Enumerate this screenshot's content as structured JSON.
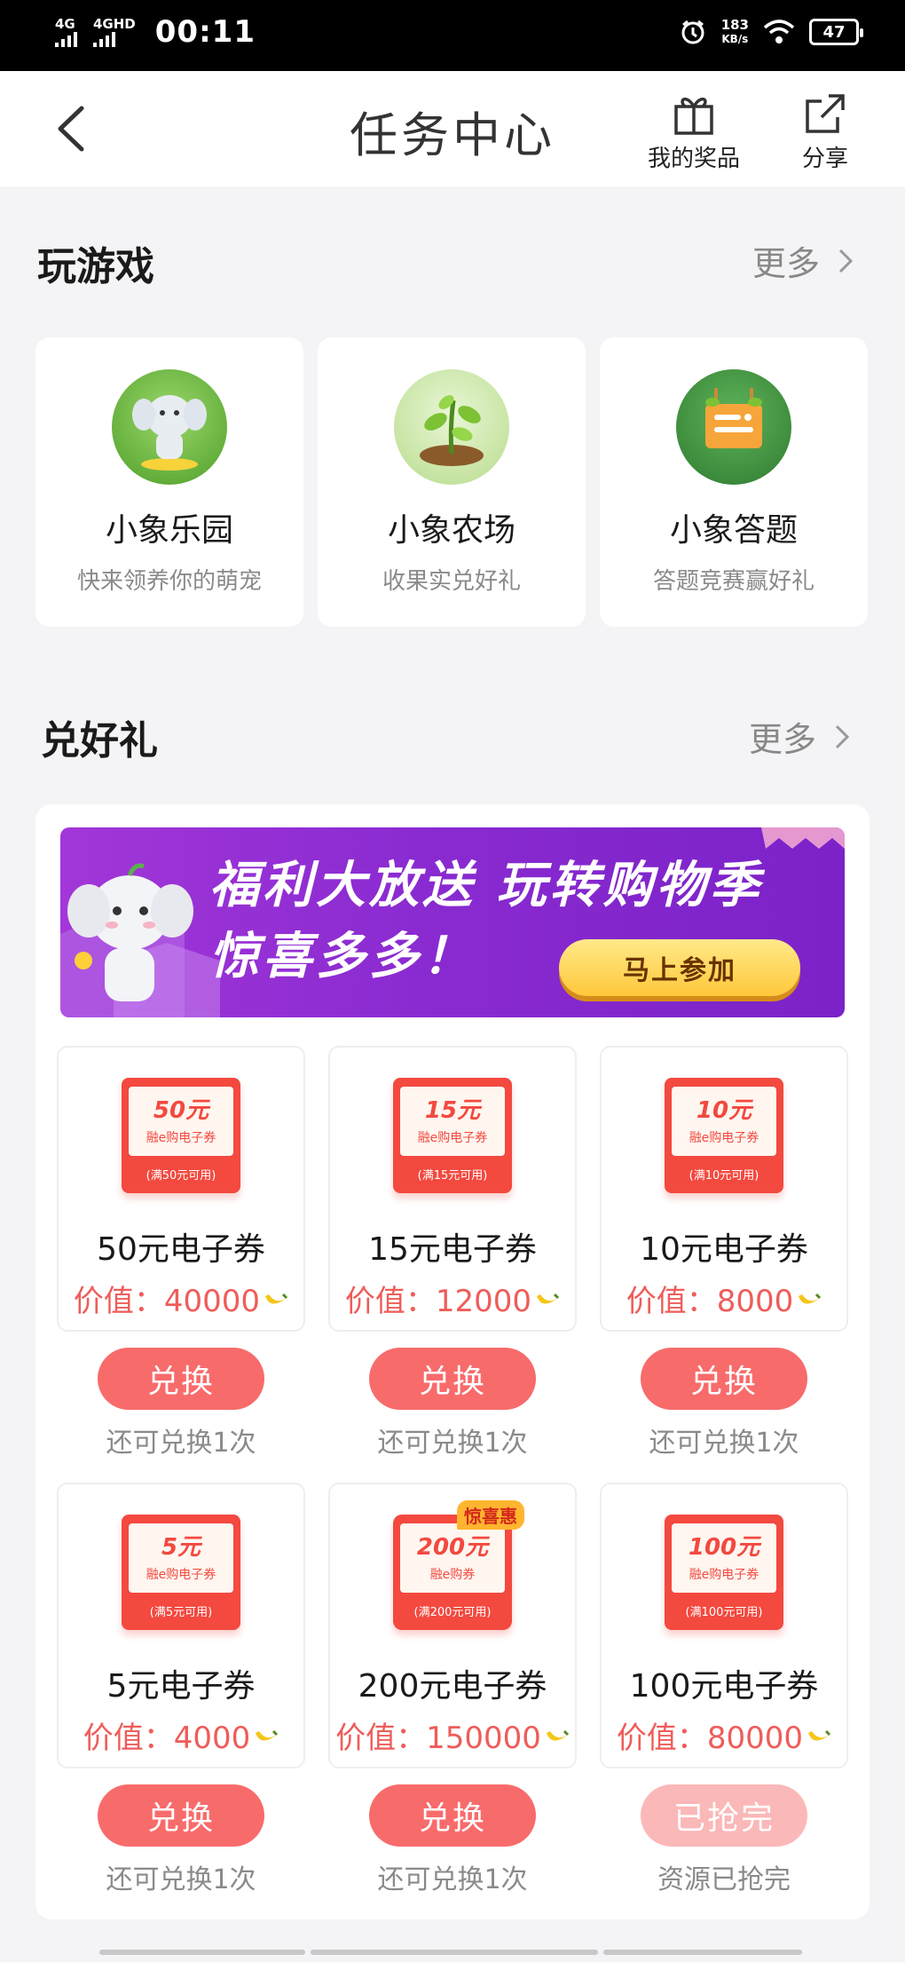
{
  "status_bar": {
    "network1": "4G",
    "network2": "4GHD",
    "time": "00:11",
    "speed_value": "183",
    "speed_unit": "KB/s",
    "battery": "47"
  },
  "header": {
    "title": "任务中心",
    "my_prizes_label": "我的奖品",
    "share_label": "分享"
  },
  "games_section": {
    "title": "玩游戏",
    "more": "更多",
    "items": [
      {
        "name": "小象乐园",
        "desc": "快来领养你的萌宠",
        "icon": "elephant-icon"
      },
      {
        "name": "小象农场",
        "desc": "收果实兑好礼",
        "icon": "sprout-icon"
      },
      {
        "name": "小象答题",
        "desc": "答题竞赛赢好礼",
        "icon": "quiz-board-icon"
      }
    ]
  },
  "gifts_section": {
    "title": "兑好礼",
    "more": "更多",
    "banner": {
      "line1": "福利大放送  玩转购物季",
      "line2": "惊喜多多！",
      "button": "马上参加"
    },
    "prizes": [
      {
        "amount": "50元",
        "type": "融e购电子券",
        "cond": "(满50元可用)",
        "name": "50元电子券",
        "value": "价值：40000",
        "button": "兑换",
        "remain": "还可兑换1次",
        "disabled": false
      },
      {
        "amount": "15元",
        "type": "融e购电子券",
        "cond": "(满15元可用)",
        "name": "15元电子券",
        "value": "价值：12000",
        "button": "兑换",
        "remain": "还可兑换1次",
        "disabled": false
      },
      {
        "amount": "10元",
        "type": "融e购电子券",
        "cond": "(满10元可用)",
        "name": "10元电子券",
        "value": "价值：8000",
        "button": "兑换",
        "remain": "还可兑换1次",
        "disabled": false
      },
      {
        "amount": "5元",
        "type": "融e购电子券",
        "cond": "(满5元可用)",
        "name": "5元电子券",
        "value": "价值：4000",
        "button": "兑换",
        "remain": "还可兑换1次",
        "disabled": false
      },
      {
        "amount": "200元",
        "type": "融e购券",
        "cond": "(满200元可用)",
        "tag": "惊喜惠",
        "name": "200元电子券",
        "value": "价值：150000",
        "button": "兑换",
        "remain": "还可兑换1次",
        "disabled": false
      },
      {
        "amount": "100元",
        "type": "融e购电子券",
        "cond": "(满100元可用)",
        "name": "100元电子券",
        "value": "价值：80000",
        "button": "已抢完",
        "remain": "资源已抢完",
        "disabled": true
      }
    ]
  },
  "colors": {
    "accent": "#f86b6b",
    "price": "#ee5d5a",
    "banner": "#8a2bd1"
  }
}
